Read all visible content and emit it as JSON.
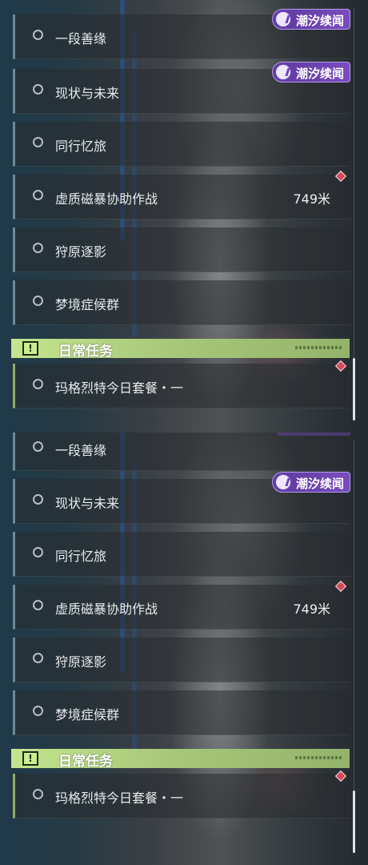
{
  "event_badge_label": "潮汐续闻",
  "quests": [
    {
      "name": "一段善缘"
    },
    {
      "name": "现状与未来"
    },
    {
      "name": "同行忆旅"
    },
    {
      "name": "虚质磁暴协助作战",
      "distance": "749米"
    },
    {
      "name": "狩原逐影"
    },
    {
      "name": "梦境症候群"
    }
  ],
  "daily_section": {
    "title": "日常任务",
    "icon": "exclamation-icon"
  },
  "daily_quest": {
    "name": "玛格烈特今日套餐・一"
  },
  "colors": {
    "accent_green": "#c4e58e",
    "event_purple": "#7a4cc0",
    "marker_red": "#d54a5b"
  }
}
